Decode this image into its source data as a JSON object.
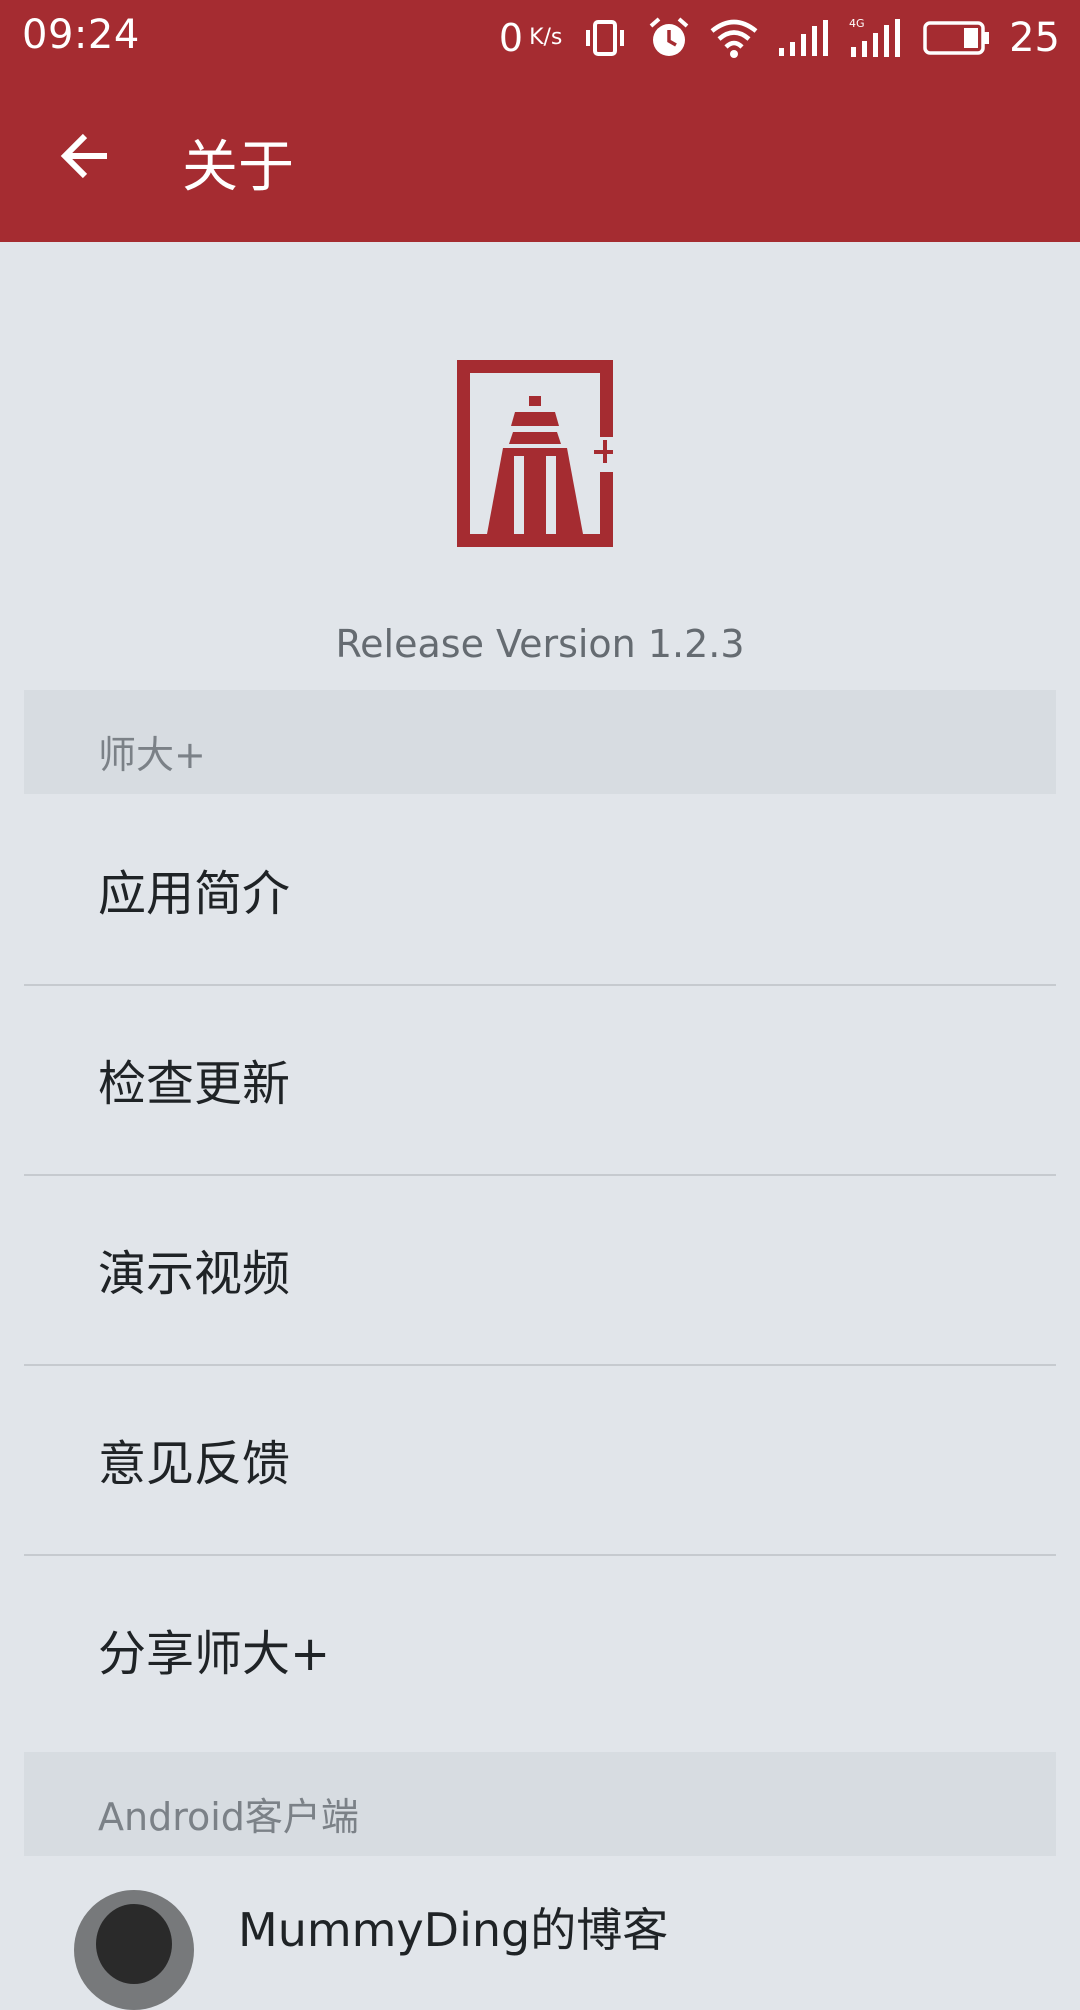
{
  "status_bar": {
    "time": "09:24",
    "net_speed_value": "0",
    "net_speed_unit": "K/s",
    "battery_level": "25",
    "icons": [
      "vibrate-icon",
      "alarm-icon",
      "wifi-icon",
      "signal-icon",
      "signal-4g-icon",
      "battery-icon"
    ]
  },
  "app_bar": {
    "title": "关于",
    "back_icon": "arrow-left-icon"
  },
  "about": {
    "version": "Release Version 1.2.3"
  },
  "sections": {
    "main_header": "师大+",
    "android_header": "Android客户端"
  },
  "menu": {
    "intro": "应用简介",
    "check_update": "检查更新",
    "demo_video": "演示视频",
    "feedback": "意见反馈",
    "share": "分享师大+"
  },
  "blog": {
    "title": "MummyDing的博客"
  },
  "colors": {
    "primary": "#a52c31",
    "background": "#e1e5ea",
    "section_header": "#d7dce1"
  }
}
